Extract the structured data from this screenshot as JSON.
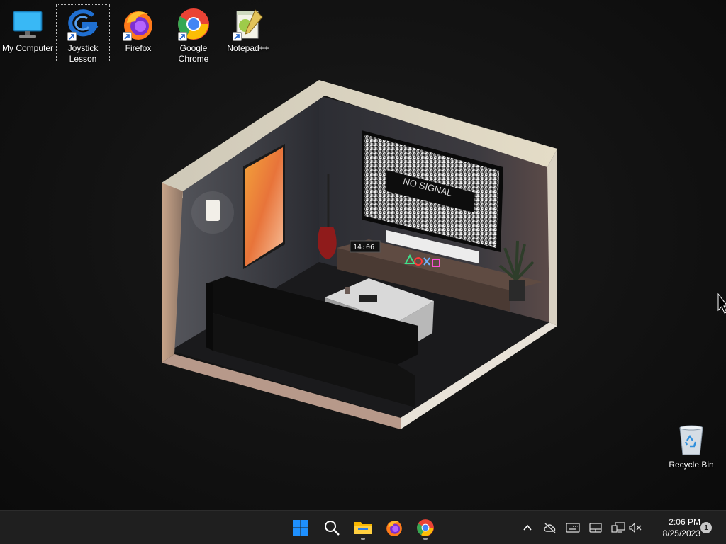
{
  "desktop_icons": [
    {
      "label": "My Computer",
      "icon": "monitor-icon",
      "shortcut": false,
      "selected": false
    },
    {
      "label": "Joystick Lesson",
      "icon": "g-logo-icon",
      "shortcut": true,
      "selected": true
    },
    {
      "label": "Firefox",
      "icon": "firefox-icon",
      "shortcut": true,
      "selected": false
    },
    {
      "label": "Google Chrome",
      "icon": "chrome-icon",
      "shortcut": true,
      "selected": false
    },
    {
      "label": "Notepad++",
      "icon": "notepadpp-icon",
      "shortcut": true,
      "selected": false
    }
  ],
  "recycle_bin": {
    "label": "Recycle Bin"
  },
  "wallpaper": {
    "tv_text": "NO SIGNAL",
    "clock_text": "14:06"
  },
  "taskbar": {
    "pinned": [
      "start-icon",
      "search-icon",
      "file-explorer-icon",
      "firefox-icon",
      "chrome-icon"
    ],
    "tray": [
      "chevron-up-icon",
      "cloud-offline-icon",
      "keyboard-icon",
      "touchpad-icon",
      "network-icon",
      "volume-muted-icon"
    ],
    "time": "2:06 PM",
    "date": "8/25/2023",
    "notification_count": "1"
  },
  "colors": {
    "taskbar_bg": "#1f1f1f",
    "desktop_bg": "#141414",
    "start_blue": "#1e90ff"
  }
}
